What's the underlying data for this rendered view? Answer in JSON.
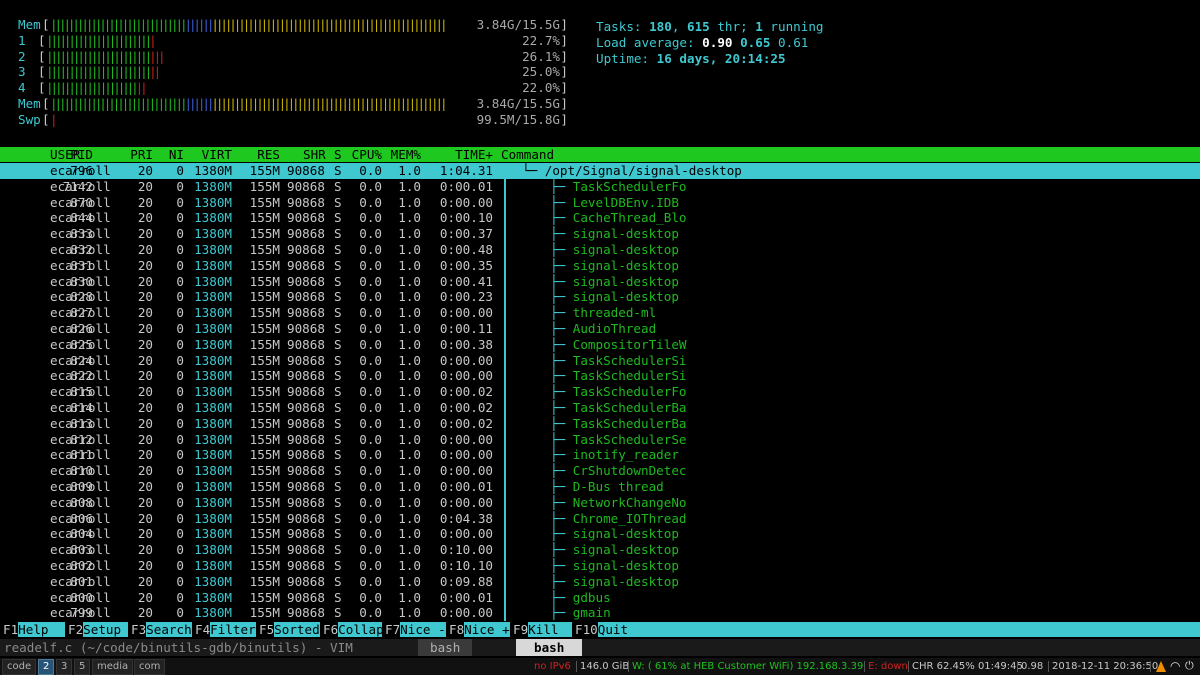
{
  "meters": {
    "mem_top": {
      "label": "Mem",
      "value": "3.84G/15.5G"
    },
    "cpu1": {
      "label": "1",
      "value": "22.7%"
    },
    "cpu2": {
      "label": "2",
      "value": "26.1%"
    },
    "cpu3": {
      "label": "3",
      "value": "25.0%"
    },
    "cpu4": {
      "label": "4",
      "value": "22.0%"
    },
    "mem": {
      "label": "Mem",
      "value": "3.84G/15.5G"
    },
    "swp": {
      "label": "Swp",
      "value": "99.5M/15.8G"
    }
  },
  "summary": {
    "tasks_label": "Tasks: ",
    "tasks": "180",
    "thr": "615",
    "thr_label": " thr; ",
    "running": "1",
    "running_label": " running",
    "load_label": "Load average: ",
    "load1": "0.90",
    "load5": "0.65",
    "load15": "0.61",
    "uptime_label": "Uptime: ",
    "uptime": "16 days, 20:14:25"
  },
  "header": {
    "pid": "PID",
    "user": "USER",
    "pri": "PRI",
    "ni": "NI",
    "virt": "VIRT",
    "res": "RES",
    "shr": "SHR",
    "s": "S",
    "cpu": "CPU%",
    "mem": "MEM%",
    "time": "TIME+",
    "command": "Command"
  },
  "processes": [
    {
      "pid": "796",
      "user": "ecarroll",
      "pri": "20",
      "ni": "0",
      "virt": "1380M",
      "res": "155M",
      "shr": "90868",
      "s": "S",
      "cpu": "0.0",
      "mem": "1.0",
      "time": "1:04.31",
      "tree": "└─",
      "cmd": "/opt/Signal/signal-desktop"
    },
    {
      "pid": "7142",
      "user": "ecarroll",
      "pri": "20",
      "ni": "0",
      "virt": "1380M",
      "res": "155M",
      "shr": "90868",
      "s": "S",
      "cpu": "0.0",
      "mem": "1.0",
      "time": "0:00.01",
      "tree": "├─",
      "cmd": "TaskSchedulerFo"
    },
    {
      "pid": "870",
      "user": "ecarroll",
      "pri": "20",
      "ni": "0",
      "virt": "1380M",
      "res": "155M",
      "shr": "90868",
      "s": "S",
      "cpu": "0.0",
      "mem": "1.0",
      "time": "0:00.00",
      "tree": "├─",
      "cmd": "LevelDBEnv.IDB"
    },
    {
      "pid": "844",
      "user": "ecarroll",
      "pri": "20",
      "ni": "0",
      "virt": "1380M",
      "res": "155M",
      "shr": "90868",
      "s": "S",
      "cpu": "0.0",
      "mem": "1.0",
      "time": "0:00.10",
      "tree": "├─",
      "cmd": "CacheThread_Blo"
    },
    {
      "pid": "833",
      "user": "ecarroll",
      "pri": "20",
      "ni": "0",
      "virt": "1380M",
      "res": "155M",
      "shr": "90868",
      "s": "S",
      "cpu": "0.0",
      "mem": "1.0",
      "time": "0:00.37",
      "tree": "├─",
      "cmd": "signal-desktop"
    },
    {
      "pid": "832",
      "user": "ecarroll",
      "pri": "20",
      "ni": "0",
      "virt": "1380M",
      "res": "155M",
      "shr": "90868",
      "s": "S",
      "cpu": "0.0",
      "mem": "1.0",
      "time": "0:00.48",
      "tree": "├─",
      "cmd": "signal-desktop"
    },
    {
      "pid": "831",
      "user": "ecarroll",
      "pri": "20",
      "ni": "0",
      "virt": "1380M",
      "res": "155M",
      "shr": "90868",
      "s": "S",
      "cpu": "0.0",
      "mem": "1.0",
      "time": "0:00.35",
      "tree": "├─",
      "cmd": "signal-desktop"
    },
    {
      "pid": "830",
      "user": "ecarroll",
      "pri": "20",
      "ni": "0",
      "virt": "1380M",
      "res": "155M",
      "shr": "90868",
      "s": "S",
      "cpu": "0.0",
      "mem": "1.0",
      "time": "0:00.41",
      "tree": "├─",
      "cmd": "signal-desktop"
    },
    {
      "pid": "828",
      "user": "ecarroll",
      "pri": "20",
      "ni": "0",
      "virt": "1380M",
      "res": "155M",
      "shr": "90868",
      "s": "S",
      "cpu": "0.0",
      "mem": "1.0",
      "time": "0:00.23",
      "tree": "├─",
      "cmd": "signal-desktop"
    },
    {
      "pid": "827",
      "user": "ecarroll",
      "pri": "20",
      "ni": "0",
      "virt": "1380M",
      "res": "155M",
      "shr": "90868",
      "s": "S",
      "cpu": "0.0",
      "mem": "1.0",
      "time": "0:00.00",
      "tree": "├─",
      "cmd": "threaded-ml"
    },
    {
      "pid": "826",
      "user": "ecarroll",
      "pri": "20",
      "ni": "0",
      "virt": "1380M",
      "res": "155M",
      "shr": "90868",
      "s": "S",
      "cpu": "0.0",
      "mem": "1.0",
      "time": "0:00.11",
      "tree": "├─",
      "cmd": "AudioThread"
    },
    {
      "pid": "825",
      "user": "ecarroll",
      "pri": "20",
      "ni": "0",
      "virt": "1380M",
      "res": "155M",
      "shr": "90868",
      "s": "S",
      "cpu": "0.0",
      "mem": "1.0",
      "time": "0:00.38",
      "tree": "├─",
      "cmd": "CompositorTileW"
    },
    {
      "pid": "824",
      "user": "ecarroll",
      "pri": "20",
      "ni": "0",
      "virt": "1380M",
      "res": "155M",
      "shr": "90868",
      "s": "S",
      "cpu": "0.0",
      "mem": "1.0",
      "time": "0:00.00",
      "tree": "├─",
      "cmd": "TaskSchedulerSi"
    },
    {
      "pid": "822",
      "user": "ecarroll",
      "pri": "20",
      "ni": "0",
      "virt": "1380M",
      "res": "155M",
      "shr": "90868",
      "s": "S",
      "cpu": "0.0",
      "mem": "1.0",
      "time": "0:00.00",
      "tree": "├─",
      "cmd": "TaskSchedulerSi"
    },
    {
      "pid": "815",
      "user": "ecarroll",
      "pri": "20",
      "ni": "0",
      "virt": "1380M",
      "res": "155M",
      "shr": "90868",
      "s": "S",
      "cpu": "0.0",
      "mem": "1.0",
      "time": "0:00.02",
      "tree": "├─",
      "cmd": "TaskSchedulerFo"
    },
    {
      "pid": "814",
      "user": "ecarroll",
      "pri": "20",
      "ni": "0",
      "virt": "1380M",
      "res": "155M",
      "shr": "90868",
      "s": "S",
      "cpu": "0.0",
      "mem": "1.0",
      "time": "0:00.02",
      "tree": "├─",
      "cmd": "TaskSchedulerBa"
    },
    {
      "pid": "813",
      "user": "ecarroll",
      "pri": "20",
      "ni": "0",
      "virt": "1380M",
      "res": "155M",
      "shr": "90868",
      "s": "S",
      "cpu": "0.0",
      "mem": "1.0",
      "time": "0:00.02",
      "tree": "├─",
      "cmd": "TaskSchedulerBa"
    },
    {
      "pid": "812",
      "user": "ecarroll",
      "pri": "20",
      "ni": "0",
      "virt": "1380M",
      "res": "155M",
      "shr": "90868",
      "s": "S",
      "cpu": "0.0",
      "mem": "1.0",
      "time": "0:00.00",
      "tree": "├─",
      "cmd": "TaskSchedulerSe"
    },
    {
      "pid": "811",
      "user": "ecarroll",
      "pri": "20",
      "ni": "0",
      "virt": "1380M",
      "res": "155M",
      "shr": "90868",
      "s": "S",
      "cpu": "0.0",
      "mem": "1.0",
      "time": "0:00.00",
      "tree": "├─",
      "cmd": "inotify_reader"
    },
    {
      "pid": "810",
      "user": "ecarroll",
      "pri": "20",
      "ni": "0",
      "virt": "1380M",
      "res": "155M",
      "shr": "90868",
      "s": "S",
      "cpu": "0.0",
      "mem": "1.0",
      "time": "0:00.00",
      "tree": "├─",
      "cmd": "CrShutdownDetec"
    },
    {
      "pid": "809",
      "user": "ecarroll",
      "pri": "20",
      "ni": "0",
      "virt": "1380M",
      "res": "155M",
      "shr": "90868",
      "s": "S",
      "cpu": "0.0",
      "mem": "1.0",
      "time": "0:00.01",
      "tree": "├─",
      "cmd": "D-Bus thread"
    },
    {
      "pid": "808",
      "user": "ecarroll",
      "pri": "20",
      "ni": "0",
      "virt": "1380M",
      "res": "155M",
      "shr": "90868",
      "s": "S",
      "cpu": "0.0",
      "mem": "1.0",
      "time": "0:00.00",
      "tree": "├─",
      "cmd": "NetworkChangeNo"
    },
    {
      "pid": "806",
      "user": "ecarroll",
      "pri": "20",
      "ni": "0",
      "virt": "1380M",
      "res": "155M",
      "shr": "90868",
      "s": "S",
      "cpu": "0.0",
      "mem": "1.0",
      "time": "0:04.38",
      "tree": "├─",
      "cmd": "Chrome_IOThread"
    },
    {
      "pid": "804",
      "user": "ecarroll",
      "pri": "20",
      "ni": "0",
      "virt": "1380M",
      "res": "155M",
      "shr": "90868",
      "s": "S",
      "cpu": "0.0",
      "mem": "1.0",
      "time": "0:00.00",
      "tree": "├─",
      "cmd": "signal-desktop"
    },
    {
      "pid": "803",
      "user": "ecarroll",
      "pri": "20",
      "ni": "0",
      "virt": "1380M",
      "res": "155M",
      "shr": "90868",
      "s": "S",
      "cpu": "0.0",
      "mem": "1.0",
      "time": "0:10.00",
      "tree": "├─",
      "cmd": "signal-desktop"
    },
    {
      "pid": "802",
      "user": "ecarroll",
      "pri": "20",
      "ni": "0",
      "virt": "1380M",
      "res": "155M",
      "shr": "90868",
      "s": "S",
      "cpu": "0.0",
      "mem": "1.0",
      "time": "0:10.10",
      "tree": "├─",
      "cmd": "signal-desktop"
    },
    {
      "pid": "801",
      "user": "ecarroll",
      "pri": "20",
      "ni": "0",
      "virt": "1380M",
      "res": "155M",
      "shr": "90868",
      "s": "S",
      "cpu": "0.0",
      "mem": "1.0",
      "time": "0:09.88",
      "tree": "├─",
      "cmd": "signal-desktop"
    },
    {
      "pid": "800",
      "user": "ecarroll",
      "pri": "20",
      "ni": "0",
      "virt": "1380M",
      "res": "155M",
      "shr": "90868",
      "s": "S",
      "cpu": "0.0",
      "mem": "1.0",
      "time": "0:00.01",
      "tree": "├─",
      "cmd": "gdbus"
    },
    {
      "pid": "799",
      "user": "ecarroll",
      "pri": "20",
      "ni": "0",
      "virt": "1380M",
      "res": "155M",
      "shr": "90868",
      "s": "S",
      "cpu": "0.0",
      "mem": "1.0",
      "time": "0:00.00",
      "tree": "├─",
      "cmd": "gmain"
    }
  ],
  "fkeys": [
    {
      "key": "F1",
      "label": "Help"
    },
    {
      "key": "F2",
      "label": "Setup"
    },
    {
      "key": "F3",
      "label": "Search"
    },
    {
      "key": "F4",
      "label": "Filter"
    },
    {
      "key": "F5",
      "label": "Sorted"
    },
    {
      "key": "F6",
      "label": "Collap"
    },
    {
      "key": "F7",
      "label": "Nice -"
    },
    {
      "key": "F8",
      "label": "Nice +"
    },
    {
      "key": "F9",
      "label": "Kill"
    },
    {
      "key": "F10",
      "label": "Quit"
    }
  ],
  "tmux": {
    "left": "readelf.c (~/code/binutils-gdb/binutils) - VIM",
    "win1": "bash",
    "active": "bash"
  },
  "i3bar": {
    "workspaces": [
      "code",
      "2",
      "3",
      "5",
      "media",
      "com"
    ],
    "focused": "2",
    "ipv6": "no IPv6",
    "disk": "146.0 GiB",
    "wifi": "W: ( 61% at HEB Customer WiFi) 192.168.3.39",
    "eth": "E: down",
    "battery": "CHR 62.45% 01:49:45",
    "load": "0.98",
    "datetime": "2018-12-11 20:36:50"
  },
  "colors": {
    "header_bg": "#1ec81e",
    "selection_bg": "#3fc8d0",
    "cpu_low": "#1fb81f",
    "cpu_high": "#c81e1e",
    "mem_cache": "#c8b400",
    "mem_buffer": "#3a5fd8"
  }
}
